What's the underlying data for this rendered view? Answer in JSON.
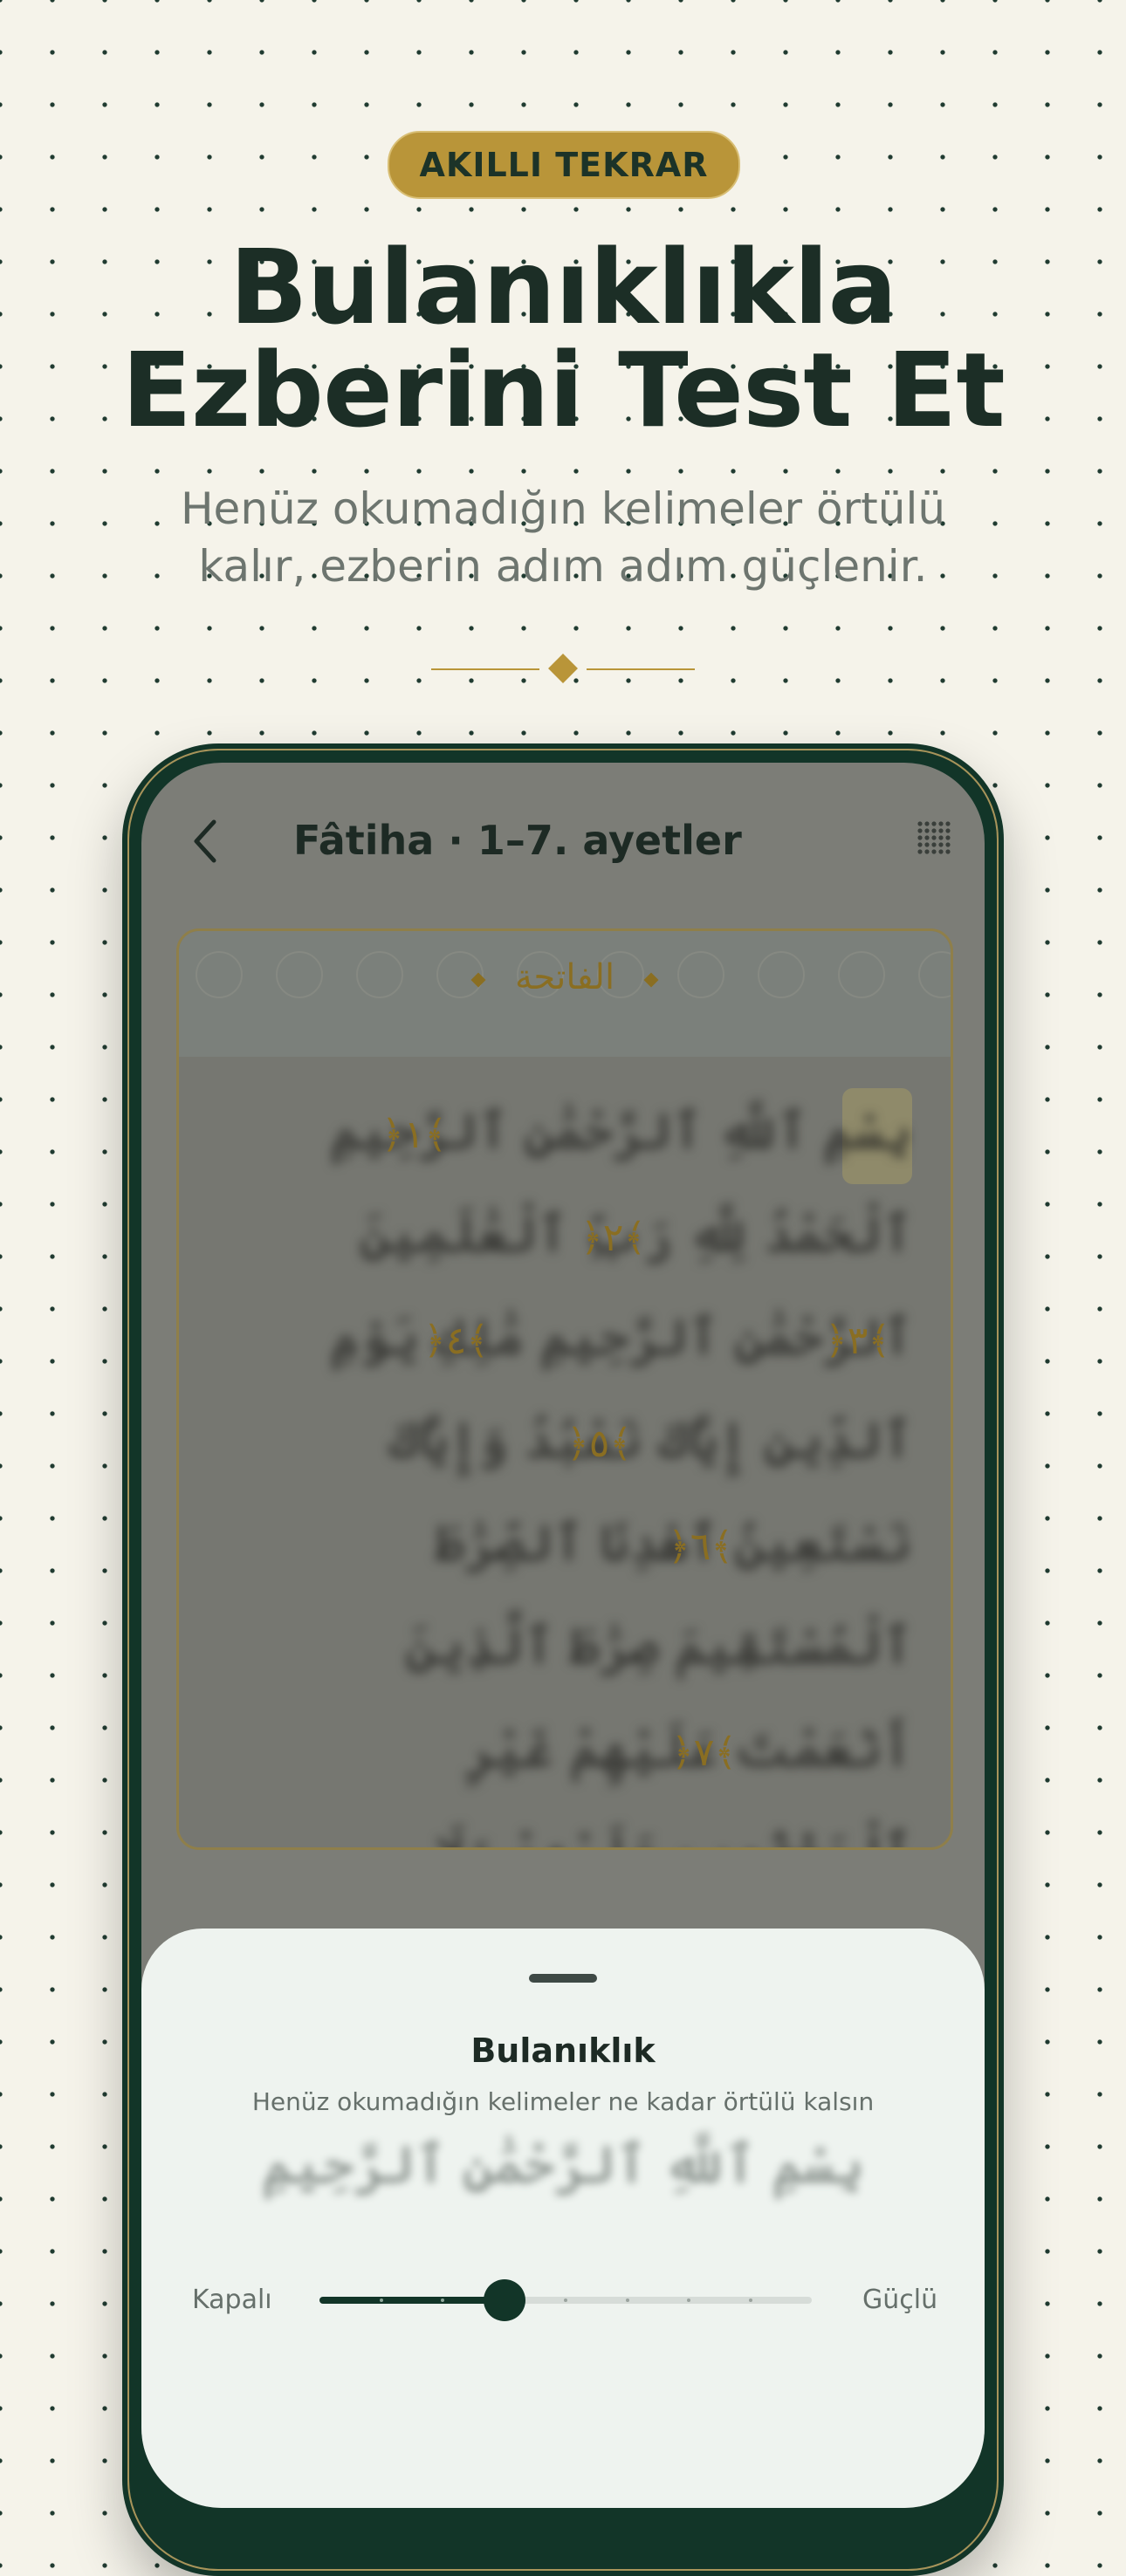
{
  "badge": "AKILLI TEKRAR",
  "headline": {
    "line1": "Bulanıklıkla",
    "line2": "Ezberini Test Et"
  },
  "subtitle": {
    "line1": "Henüz okumadığın kelimeler örtülü",
    "line2": "kalır, ezberin adım adım güçlenir."
  },
  "colors": {
    "accent": "#b99539",
    "dark_green": "#123528",
    "background": "#f5f3ea"
  },
  "screen": {
    "title": "Fâtiha · 1–7. ayetler",
    "back_icon": "chevron-left-icon",
    "grid_icon": "dot-grid-icon",
    "surah_name": "الفاتحة",
    "verses": [
      "بِسْمِ ٱللَّهِ ٱلرَّحْمَٰنِ ٱلرَّحِيمِ",
      "ٱلْحَمْدُ لِلَّهِ رَبِّ ٱلْعَٰلَمِينَ",
      "ٱلرَّحْمَٰنِ ٱلرَّحِيمِ",
      "مَٰلِكِ يَوْمِ ٱلدِّينِ",
      "إِيَّاكَ نَعْبُدُ وَإِيَّاكَ نَسْتَعِينُ",
      "ٱهْدِنَا ٱلصِّرَٰطَ ٱلْمُسْتَقِيمَ",
      "صِرَٰطَ ٱلَّذِينَ أَنْعَمْتَ عَلَيْهِمْ غَيْرِ ٱلْمَغْضُوبِ عَلَيْهِمْ وَلَا ٱلضَّآلِّينَ"
    ],
    "ayah_markers": [
      "﴿١﴾",
      "﴿٢﴾",
      "﴿٣﴾",
      "﴿٤﴾",
      "﴿٥﴾",
      "﴿٦﴾",
      "﴿٧﴾"
    ]
  },
  "sheet": {
    "title": "Bulanıklık",
    "description": "Henüz okumadığın kelimeler ne kadar örtülü kalsın",
    "preview": "بِسْمِ ٱللَّهِ ٱلرَّحْمَٰنِ ٱلرَّحِيمِ",
    "min_label": "Kapalı",
    "max_label": "Güçlü",
    "slider_value": 0.375,
    "slider_steps": 8
  }
}
